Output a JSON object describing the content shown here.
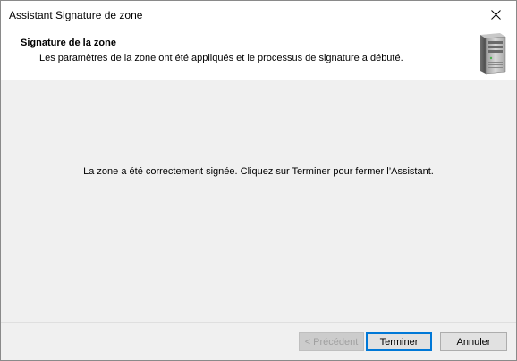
{
  "window": {
    "title": "Assistant Signature de zone",
    "close_icon": "close-icon"
  },
  "header": {
    "title": "Signature de la zone",
    "description": "Les paramètres de la zone ont été appliqués et le processus de signature a débuté.",
    "icon": "server-icon"
  },
  "main": {
    "message": "La zone a été correctement signée. Cliquez sur Terminer pour fermer l’Assistant."
  },
  "footer": {
    "previous_label": "< Précédent",
    "previous_enabled": false,
    "finish_label": "Terminer",
    "cancel_label": "Annuler"
  }
}
